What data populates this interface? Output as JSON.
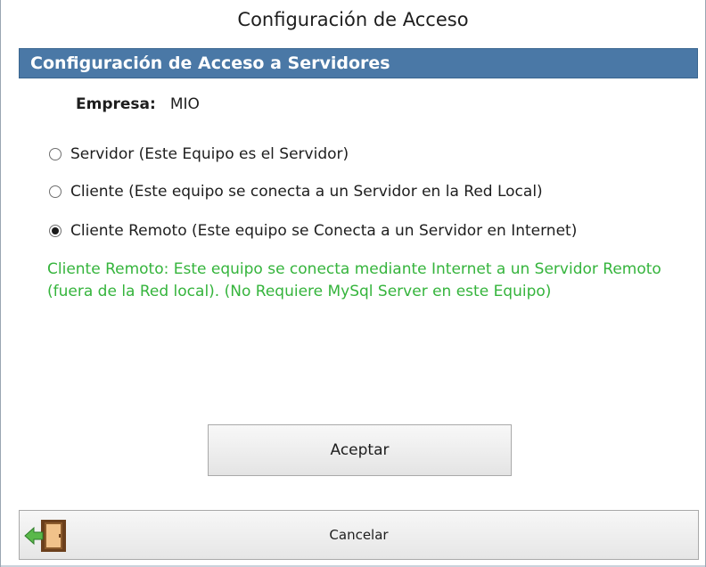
{
  "window": {
    "title": "Configuración de Acceso"
  },
  "section": {
    "header": "Configuración de Acceso a Servidores"
  },
  "company": {
    "label": "Empresa:",
    "value": "MIO"
  },
  "options": [
    {
      "label": "Servidor (Este Equipo es el Servidor)",
      "selected": false
    },
    {
      "label": "Cliente (Este equipo se conecta a un Servidor en la Red Local)",
      "selected": false
    },
    {
      "label": "Cliente Remoto (Este equipo se Conecta a un Servidor en Internet)",
      "selected": true
    }
  ],
  "note": {
    "text": "Cliente Remoto: Este equipo se conecta mediante Internet a un Servidor Remoto (fuera de la Red local). (No Requiere MySql Server en este Equipo)",
    "color": "#35b43c"
  },
  "buttons": {
    "accept_label": "Aceptar",
    "cancel_label": "Cancelar",
    "cancel_icon": "exit-door-icon"
  },
  "colors": {
    "header_bg": "#4a78a6"
  }
}
